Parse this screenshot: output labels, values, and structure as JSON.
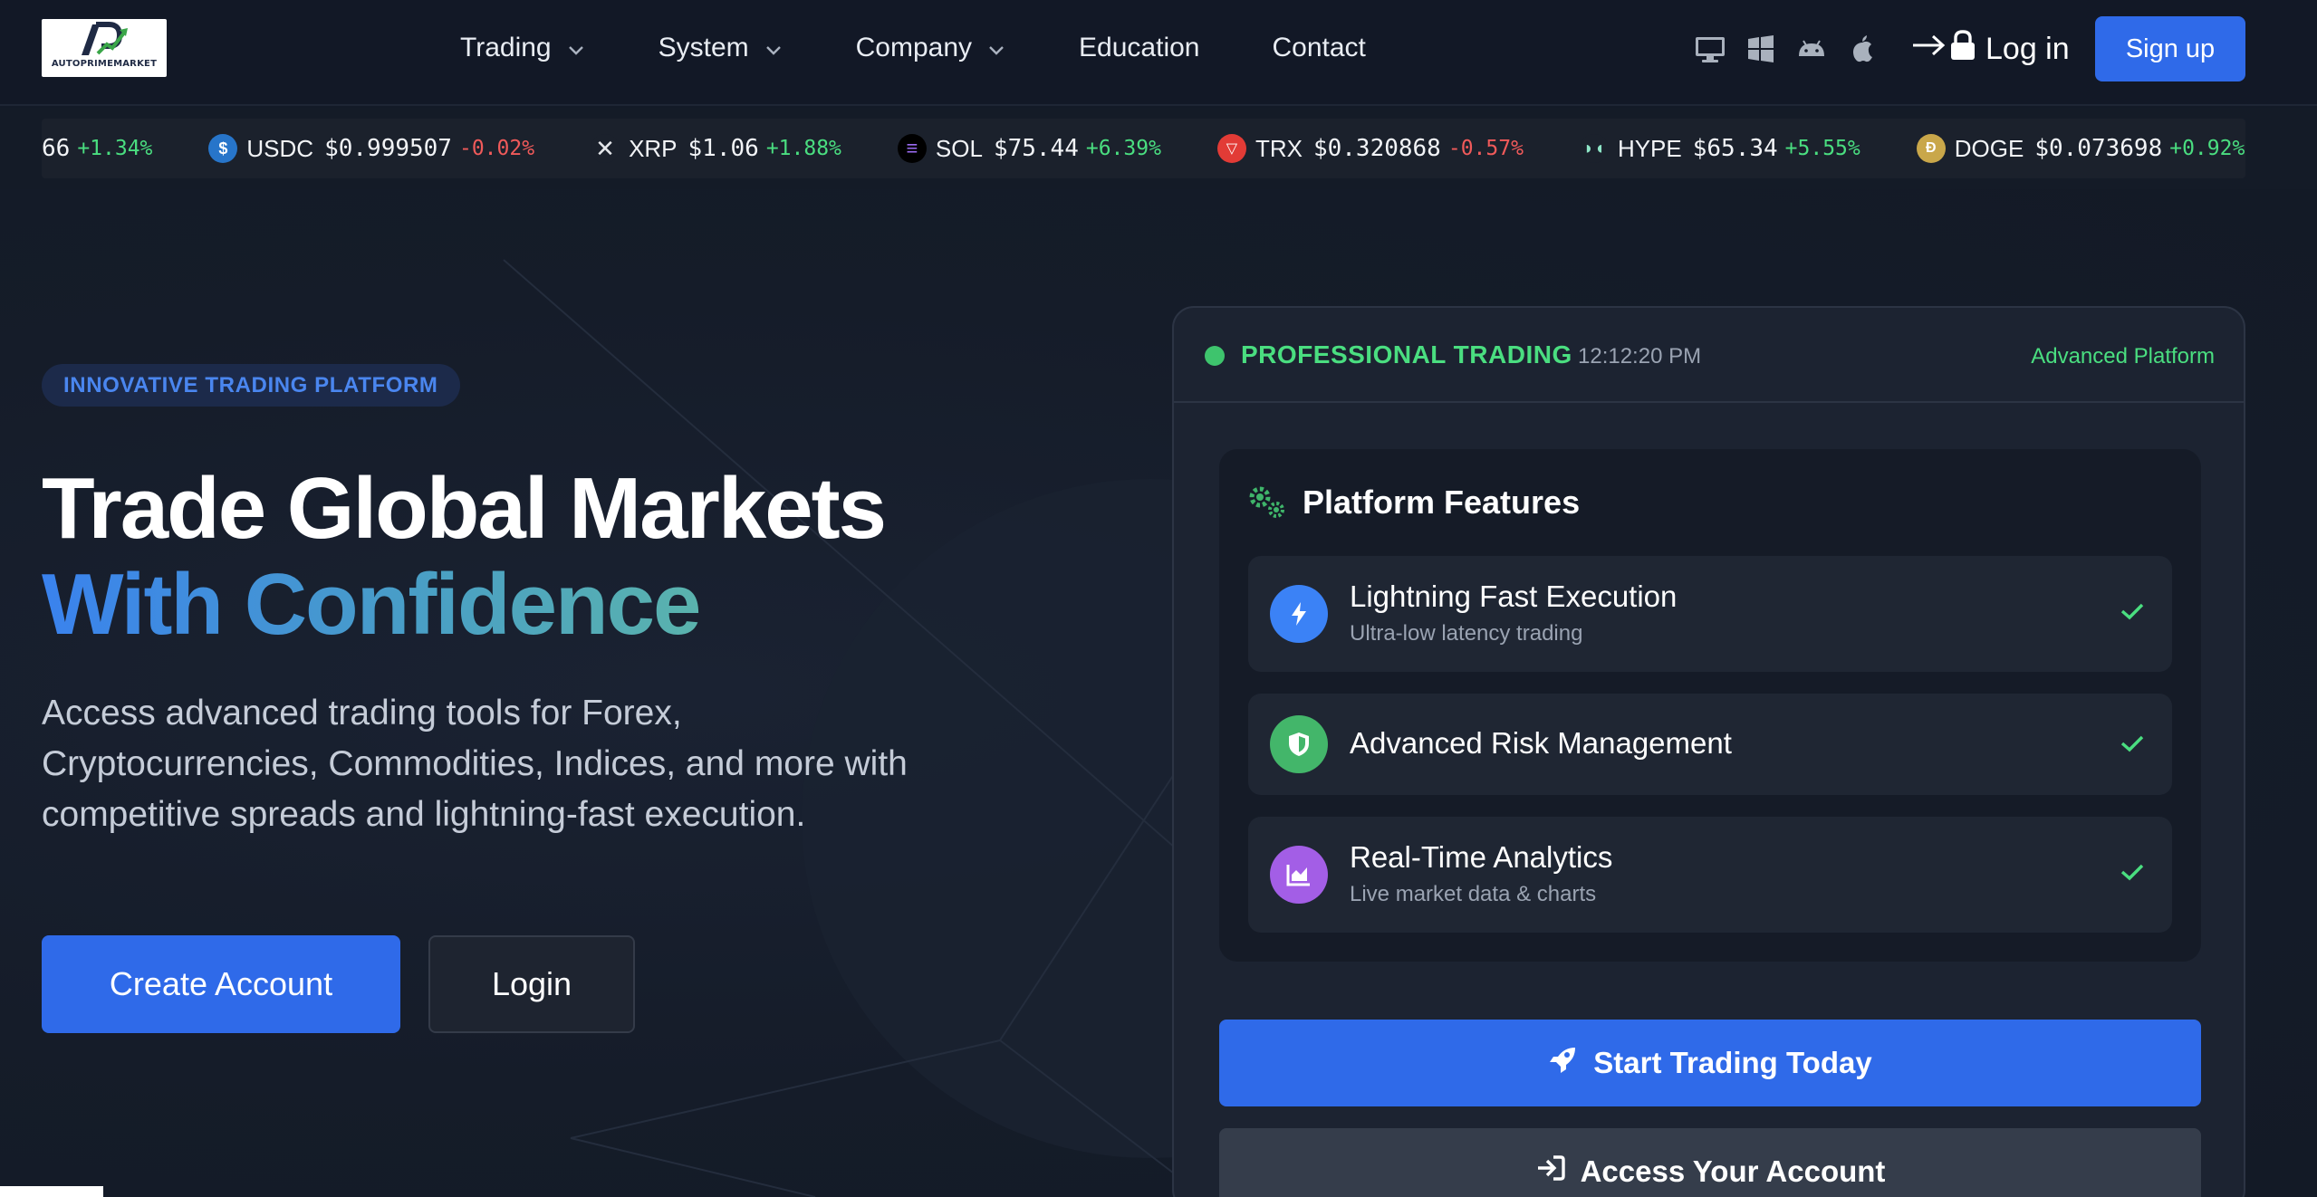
{
  "brand": {
    "logo_text": "AUTOPRIMEMARKET"
  },
  "nav": {
    "items": [
      {
        "label": "Trading",
        "has_dropdown": true
      },
      {
        "label": "System",
        "has_dropdown": true
      },
      {
        "label": "Company",
        "has_dropdown": true
      },
      {
        "label": "Education",
        "has_dropdown": false
      },
      {
        "label": "Contact",
        "has_dropdown": false
      }
    ],
    "os_icons": [
      "desktop-icon",
      "windows-icon",
      "android-icon",
      "apple-icon"
    ],
    "login_label": "Log in",
    "signup_label": "Sign up"
  },
  "ticker": [
    {
      "symbol": "",
      "price": "66",
      "change": "+1.34%",
      "direction": "up",
      "icon": "none"
    },
    {
      "symbol": "USDC",
      "price": "$0.999507",
      "change": "-0.02%",
      "direction": "down",
      "icon": "usdc-icon"
    },
    {
      "symbol": "XRP",
      "price": "$1.06",
      "change": "+1.88%",
      "direction": "up",
      "icon": "xrp-icon"
    },
    {
      "symbol": "SOL",
      "price": "$75.44",
      "change": "+6.39%",
      "direction": "up",
      "icon": "sol-icon"
    },
    {
      "symbol": "TRX",
      "price": "$0.320868",
      "change": "-0.57%",
      "direction": "down",
      "icon": "trx-icon"
    },
    {
      "symbol": "HYPE",
      "price": "$65.34",
      "change": "+5.55%",
      "direction": "up",
      "icon": "hype-icon"
    },
    {
      "symbol": "DOGE",
      "price": "$0.073698",
      "change": "+0.92%",
      "direction": "up",
      "icon": "doge-icon"
    }
  ],
  "hero": {
    "badge": "INNOVATIVE TRADING PLATFORM",
    "title_line1": "Trade Global Markets",
    "title_line2": "With Confidence",
    "lead": "Access advanced trading tools for Forex, Cryptocurrencies, Commodities, Indices, and more with competitive spreads and lightning-fast execution.",
    "create_account": "Create Account",
    "login": "Login"
  },
  "panel": {
    "status": "PROFESSIONAL TRADING",
    "time": "12:12:20 PM",
    "tag": "Advanced Platform",
    "features_title": "Platform Features",
    "features": [
      {
        "name": "Lightning Fast Execution",
        "sub": "Ultra-low latency trading",
        "icon": "bolt-icon",
        "color": "#3b82f6"
      },
      {
        "name": "Advanced Risk Management",
        "sub": "",
        "icon": "shield-icon",
        "color": "#43b66a"
      },
      {
        "name": "Real-Time Analytics",
        "sub": "Live market data & charts",
        "icon": "chart-icon",
        "color": "#a35ee6"
      }
    ],
    "cta_primary": "Start Trading Today",
    "cta_secondary": "Access Your Account"
  },
  "colors": {
    "accent": "#2f6ae9",
    "success": "#4ade80",
    "danger": "#f05a5a",
    "background": "#131a27"
  }
}
